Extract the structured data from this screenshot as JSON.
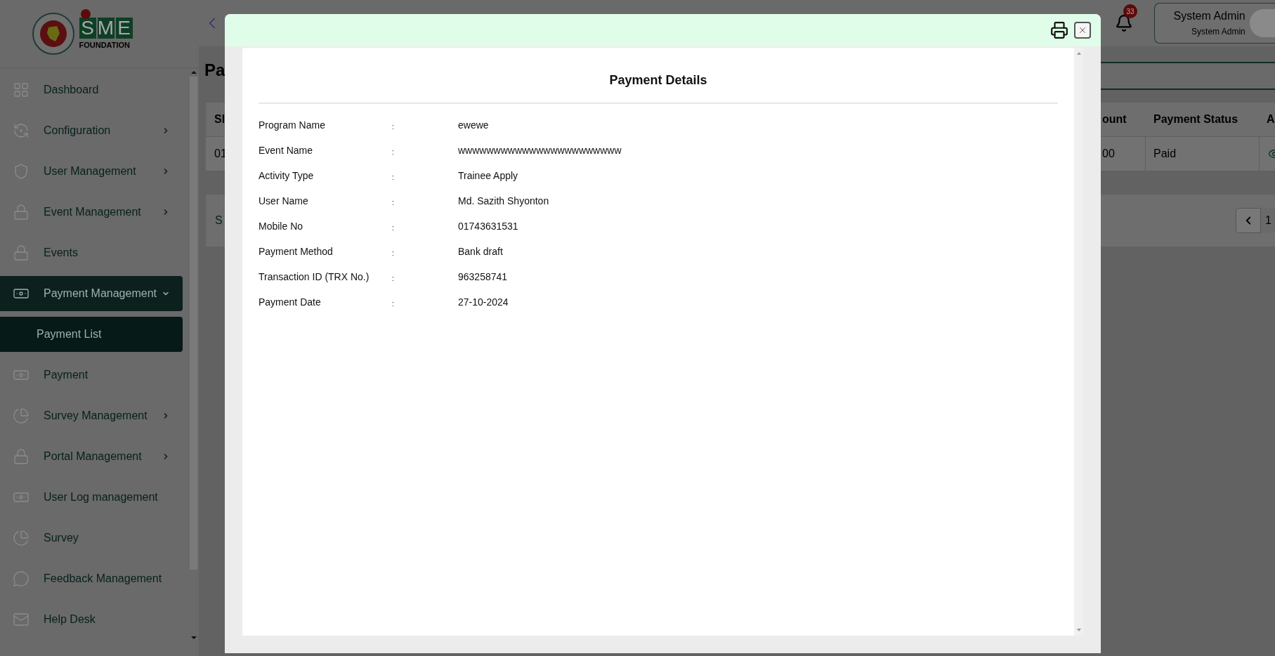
{
  "logo": {
    "letters": "SME",
    "caption": "FOUNDATION"
  },
  "sidebar": {
    "items": [
      {
        "label": "Dashboard",
        "expandable": false,
        "selected": false
      },
      {
        "label": "Configuration",
        "expandable": true,
        "expanded": false,
        "selected": false
      },
      {
        "label": "User Management",
        "expandable": true,
        "expanded": false,
        "selected": false
      },
      {
        "label": "Event Management",
        "expandable": true,
        "expanded": false,
        "selected": false
      },
      {
        "label": "Events",
        "expandable": false,
        "selected": false
      },
      {
        "label": "Payment Management",
        "expandable": true,
        "expanded": true,
        "selected": true,
        "children": [
          {
            "label": "Payment List",
            "selected": true
          }
        ]
      },
      {
        "label": "Payment",
        "expandable": false,
        "selected": false
      },
      {
        "label": "Survey Management",
        "expandable": true,
        "expanded": false,
        "selected": false
      },
      {
        "label": "Portal Management",
        "expandable": true,
        "expanded": false,
        "selected": false
      },
      {
        "label": "User Log management",
        "expandable": false,
        "selected": false
      },
      {
        "label": "Survey",
        "expandable": false,
        "selected": false
      },
      {
        "label": "Feedback Management",
        "expandable": false,
        "selected": false
      },
      {
        "label": "Help Desk",
        "expandable": false,
        "selected": false
      }
    ]
  },
  "topbar": {
    "notifications": "33",
    "user": {
      "name": "System Admin",
      "role": "System Admin"
    }
  },
  "page": {
    "title": "Pa",
    "table": {
      "columns": [
        "Sl",
        "ount",
        "Payment Status",
        "A"
      ],
      "rows": [
        [
          "01",
          "00",
          "Paid"
        ]
      ]
    },
    "footer_text": "S",
    "pagination": {
      "page": "1"
    }
  },
  "modal": {
    "title": "Payment Details",
    "fields": [
      {
        "label": "Program Name",
        "separator": ":",
        "value": "ewewe"
      },
      {
        "label": "Event Name",
        "separator": ":",
        "value": "wwwwwwwwwwwwwwwwwwwwwww"
      },
      {
        "label": "Activity Type",
        "separator": ":",
        "value": "Trainee Apply"
      },
      {
        "label": "User Name",
        "separator": ":",
        "value": "Md. Sazith Shyonton"
      },
      {
        "label": "Mobile No",
        "separator": ":",
        "value": "01743631531"
      },
      {
        "label": "Payment Method",
        "separator": ":",
        "value": "Bank draft"
      },
      {
        "label": "Transaction ID (TRX No.)",
        "separator": ":",
        "value": "963258741"
      },
      {
        "label": "Payment Date",
        "separator": ":",
        "value": "27-10-2024"
      }
    ]
  }
}
